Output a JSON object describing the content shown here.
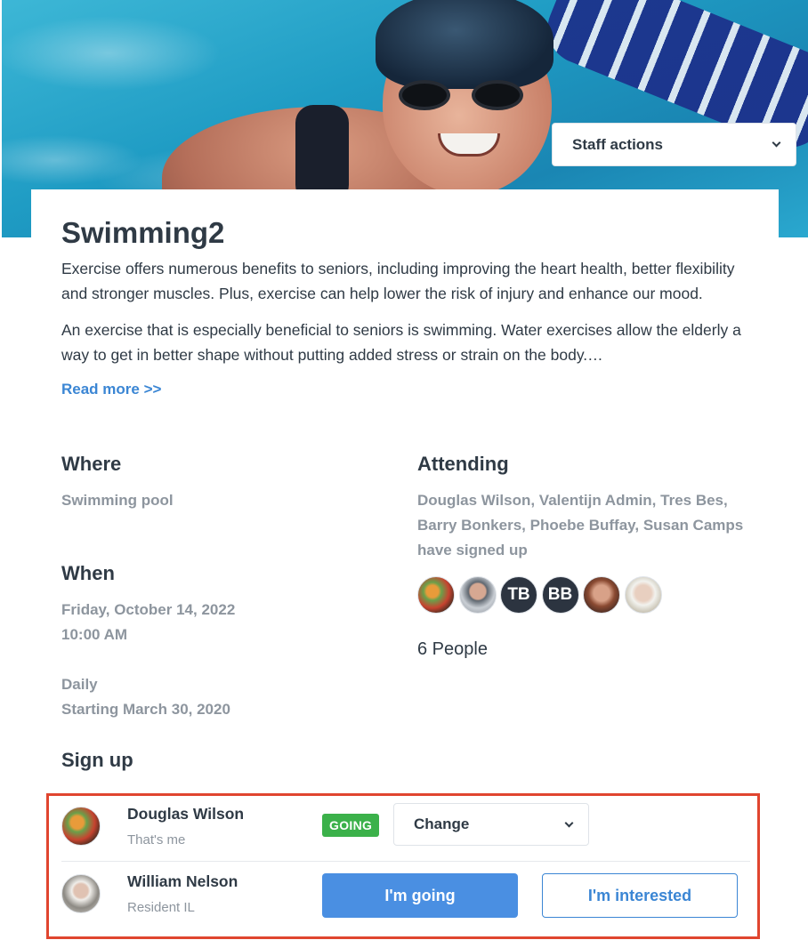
{
  "staff_actions": {
    "label": "Staff actions"
  },
  "event": {
    "title": "Swimming2",
    "description_p1": "Exercise offers numerous benefits to seniors, including improving the heart health, better flexibility and stronger muscles. Plus, exercise can help lower the risk of injury and enhance our mood.",
    "description_p2": "An exercise that is especially beneficial to seniors is swimming. Water exercises allow the elderly a way to get in better shape without putting added stress or strain on the body.…",
    "read_more": "Read more >>"
  },
  "where": {
    "heading": "Where",
    "value": "Swimming pool"
  },
  "when": {
    "heading": "When",
    "date": "Friday, October 14, 2022",
    "time": "10:00 AM",
    "recurrence": "Daily",
    "starting": "Starting March 30, 2020"
  },
  "attending": {
    "heading": "Attending",
    "names_line1": "Douglas Wilson, Valentijn Admin, Tres Bes,",
    "names_line2": "Barry Bonkers, Phoebe Buffay, Susan Camps",
    "names_line3": "have signed up",
    "avatars": [
      {
        "type": "photo",
        "icon": "food-photo"
      },
      {
        "type": "photo",
        "icon": "man-photo"
      },
      {
        "type": "initials",
        "initials": "TB"
      },
      {
        "type": "initials",
        "initials": "BB"
      },
      {
        "type": "photo",
        "icon": "woman-photo"
      },
      {
        "type": "photo",
        "icon": "elderly-woman-photo"
      }
    ],
    "count": "6 People"
  },
  "signup": {
    "heading": "Sign up",
    "rows": [
      {
        "name": "Douglas Wilson",
        "subtitle": "That's me",
        "status": "GOING",
        "change_label": "Change"
      },
      {
        "name": "William Nelson",
        "subtitle": "Resident IL",
        "going_label": "I'm going",
        "interested_label": "I'm interested"
      }
    ]
  },
  "colors": {
    "accent": "#4a8fe2",
    "link": "#3b86d4",
    "going_badge": "#3bb14a",
    "highlight_border": "#e0452f"
  }
}
